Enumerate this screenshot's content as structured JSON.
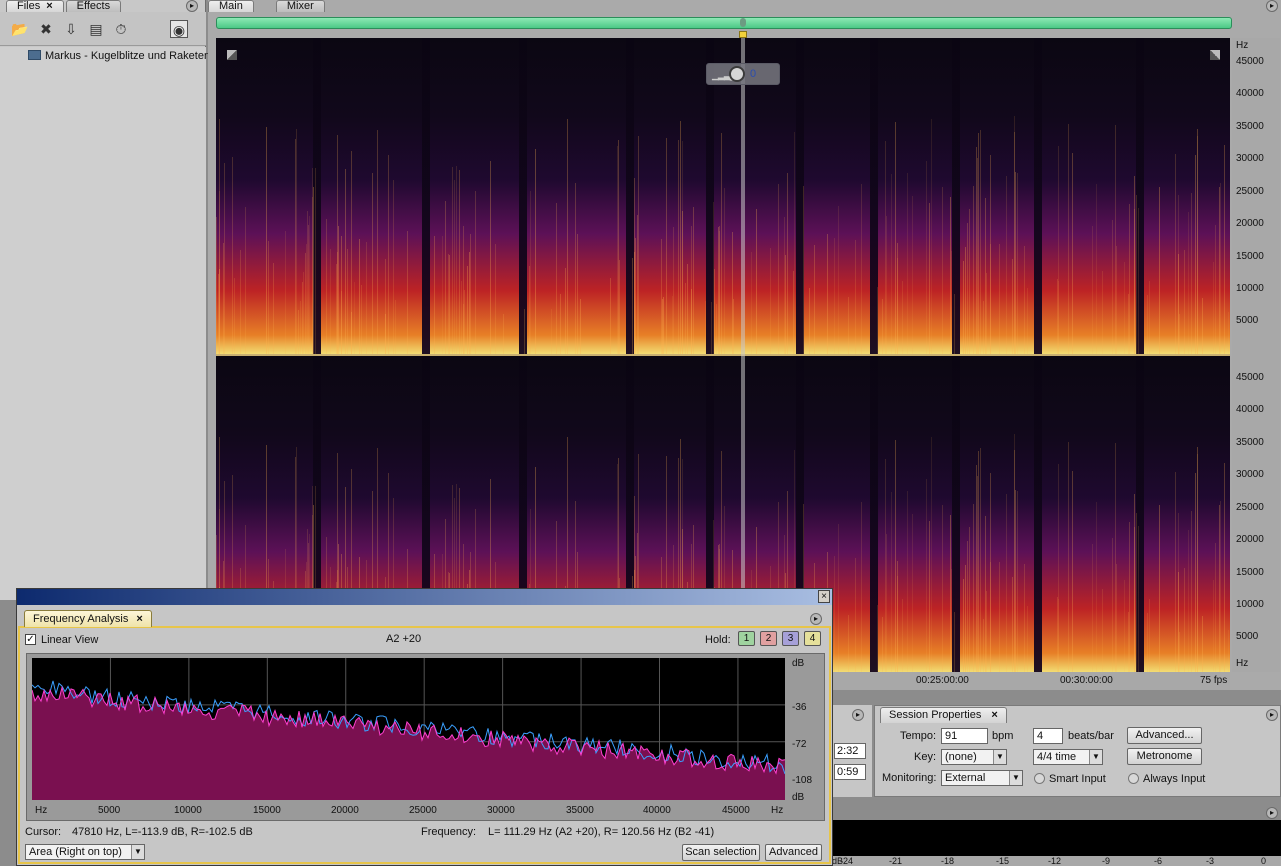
{
  "files_panel": {
    "tabs": [
      {
        "label": "Files",
        "close": "×"
      },
      {
        "label": "Effects"
      }
    ],
    "toolbar_icons": [
      "open-file-icon",
      "close-file-icon",
      "import-icon",
      "insert-multitrack-icon",
      "autoplay-icon",
      "view-options-icon"
    ],
    "items": [
      {
        "label": "Markus - Kugelblitze und Raketen"
      }
    ]
  },
  "main": {
    "tabs": [
      {
        "label": "Main"
      },
      {
        "label": "Mixer"
      }
    ],
    "hud_value": "0",
    "freq_unit": "Hz",
    "freq_ticks": [
      "45000",
      "40000",
      "35000",
      "30000",
      "25000",
      "20000",
      "15000",
      "10000",
      "5000"
    ],
    "time_labels": [
      "00:25:00:00",
      "00:30:00:00"
    ],
    "time_format": "75 fps"
  },
  "time_panel": {
    "values": [
      "2:32",
      "0:59"
    ]
  },
  "session": {
    "tab_label": "Session Properties",
    "tempo_label": "Tempo:",
    "tempo_value": "91",
    "tempo_unit": "bpm",
    "beats_value": "4",
    "beats_unit": "beats/bar",
    "advanced_button": "Advanced...",
    "key_label": "Key:",
    "key_value": "(none)",
    "time_sig_value": "4/4 time",
    "metronome_button": "Metronome",
    "monitoring_label": "Monitoring:",
    "monitoring_value": "External",
    "smart_input": "Smart Input",
    "always_input": "Always Input"
  },
  "meter": {
    "db_ticks": [
      "dB",
      "-24",
      "-21",
      "-18",
      "-15",
      "-12",
      "-9",
      "-6",
      "-3",
      "0"
    ]
  },
  "frequency_analysis": {
    "tab_label": "Frequency Analysis",
    "linear_view": "Linear View",
    "note_readout": "A2 +20",
    "hold_label": "Hold:",
    "hold_buttons": [
      "1",
      "2",
      "3",
      "4"
    ],
    "hold_colors": [
      "#9fd39f",
      "#e0a0a0",
      "#a6a0d8",
      "#e5e09a"
    ],
    "x_ticks": [
      "Hz",
      "5000",
      "10000",
      "15000",
      "20000",
      "25000",
      "30000",
      "35000",
      "40000",
      "45000",
      "Hz"
    ],
    "y_ticks": [
      "dB",
      "-36",
      "-72",
      "-108",
      "dB"
    ],
    "cursor_label": "Cursor:",
    "cursor_value": "47810 Hz, L=-113.9 dB, R=-102.5 dB",
    "frequency_label": "Frequency:",
    "frequency_value": "L= 111.29 Hz (A2 +20), R= 120.56 Hz (B2 -41)",
    "mode_value": "Area (Right on top)",
    "scan_button": "Scan selection",
    "advanced_button": "Advanced",
    "series_colors": {
      "left": "#ff40d0",
      "right": "#3aa0ff",
      "fill": "#7a1050"
    }
  }
}
